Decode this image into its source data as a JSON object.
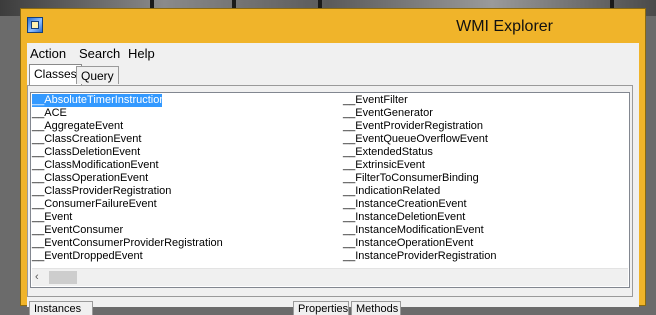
{
  "window": {
    "title": "WMI Explorer"
  },
  "menu": {
    "items": [
      "Action",
      "Search",
      "Help"
    ]
  },
  "tabs": [
    {
      "label": "Classes",
      "active": true
    },
    {
      "label": "Query",
      "active": false
    }
  ],
  "class_list": {
    "selected_index": 0,
    "left_column": [
      "__AbsoluteTimerInstruction",
      "__ACE",
      "__AggregateEvent",
      "__ClassCreationEvent",
      "__ClassDeletionEvent",
      "__ClassModificationEvent",
      "__ClassOperationEvent",
      "__ClassProviderRegistration",
      "__ConsumerFailureEvent",
      "__Event",
      "__EventConsumer",
      "__EventConsumerProviderRegistration",
      "__EventDroppedEvent"
    ],
    "right_column": [
      "__EventFilter",
      "__EventGenerator",
      "__EventProviderRegistration",
      "__EventQueueOverflowEvent",
      "__ExtendedStatus",
      "__ExtrinsicEvent",
      "__FilterToConsumerBinding",
      "__IndicationRelated",
      "__InstanceCreationEvent",
      "__InstanceDeletionEvent",
      "__InstanceModificationEvent",
      "__InstanceOperationEvent",
      "__InstanceProviderRegistration"
    ]
  },
  "scrollbar": {
    "left_arrow": "‹"
  },
  "bottom_tabs": [
    "Instances",
    "Properties",
    "Methods"
  ],
  "colors": {
    "title_bar": "#f0b42a",
    "selection": "#3399ff"
  },
  "icons": {
    "app": "wmi-app-icon"
  }
}
